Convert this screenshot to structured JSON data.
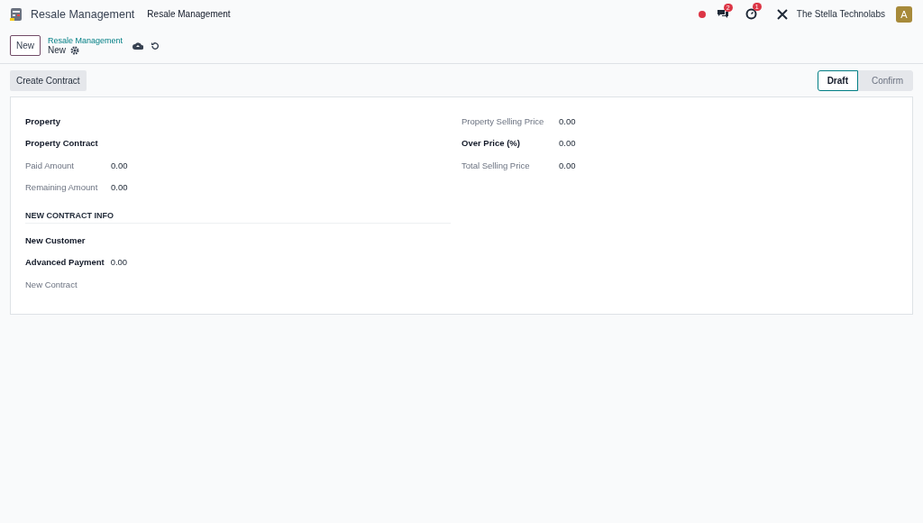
{
  "navbar": {
    "app_name": "Resale Management",
    "menu": [
      "Resale Management"
    ],
    "chat_count": "2",
    "activity_count": "1",
    "company": "The Stella Technolabs",
    "avatar": "A"
  },
  "control_panel": {
    "new_button": "New",
    "breadcrumb": "Resale Management",
    "record": "New"
  },
  "header": {
    "button": "Create Contract",
    "stages": [
      {
        "label": "Draft",
        "selected": true
      },
      {
        "label": "Confirm",
        "selected": false
      }
    ]
  },
  "left_fields": [
    {
      "label": "Property",
      "required": true
    },
    {
      "label": "Property Contract",
      "required": true
    },
    {
      "label": "Paid Amount",
      "required": false,
      "value": "0.00"
    },
    {
      "label": "Remaining Amount",
      "required": false,
      "value": "0.00"
    }
  ],
  "right_fields": [
    {
      "label": "Property Selling Price",
      "required": false,
      "value": "0.00"
    },
    {
      "label": "Over Price (%)",
      "required": true,
      "value": "0.00"
    },
    {
      "label": "Total Selling Price",
      "required": false,
      "value": "0.00"
    }
  ],
  "section": {
    "title": "NEW CONTRACT INFO",
    "fields": [
      {
        "label": "New Customer",
        "required": true
      },
      {
        "label": "Advanced Payment",
        "required": true,
        "value": "0.00"
      },
      {
        "label": "New Contract",
        "required": false
      }
    ]
  }
}
